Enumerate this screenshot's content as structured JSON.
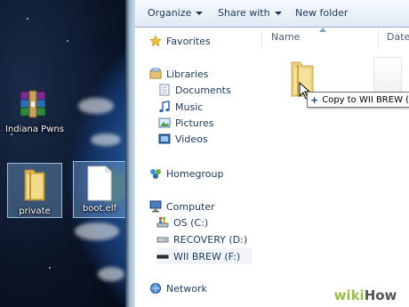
{
  "desktop": {
    "icons": [
      {
        "label": "Indiana Pwns",
        "icon": "winrar-archive-icon"
      },
      {
        "label": "private",
        "icon": "folder-icon"
      },
      {
        "label": "boot.elf",
        "icon": "file-icon"
      }
    ]
  },
  "toolbar": {
    "organize": "Organize",
    "share_with": "Share with",
    "new_folder": "New folder"
  },
  "nav": {
    "favorites": "Favorites",
    "libraries": "Libraries",
    "documents": "Documents",
    "music": "Music",
    "pictures": "Pictures",
    "videos": "Videos",
    "homegroup": "Homegroup",
    "computer": "Computer",
    "os_c": "OS (C:)",
    "recovery_d": "RECOVERY (D:)",
    "wii_brew_f": "WII BREW (F:)",
    "network": "Network"
  },
  "columns": {
    "name": "Name",
    "date": "Date m"
  },
  "drag": {
    "tooltip": "Copy to WII BREW (F:)",
    "tooltip_icon": "plus-icon"
  },
  "watermark": {
    "wiki": "wiki",
    "how": "How"
  },
  "colors": {
    "nav_text": "#1e395b",
    "selection": "#cce4f7",
    "wikihow_green": "#9bbc4c"
  }
}
